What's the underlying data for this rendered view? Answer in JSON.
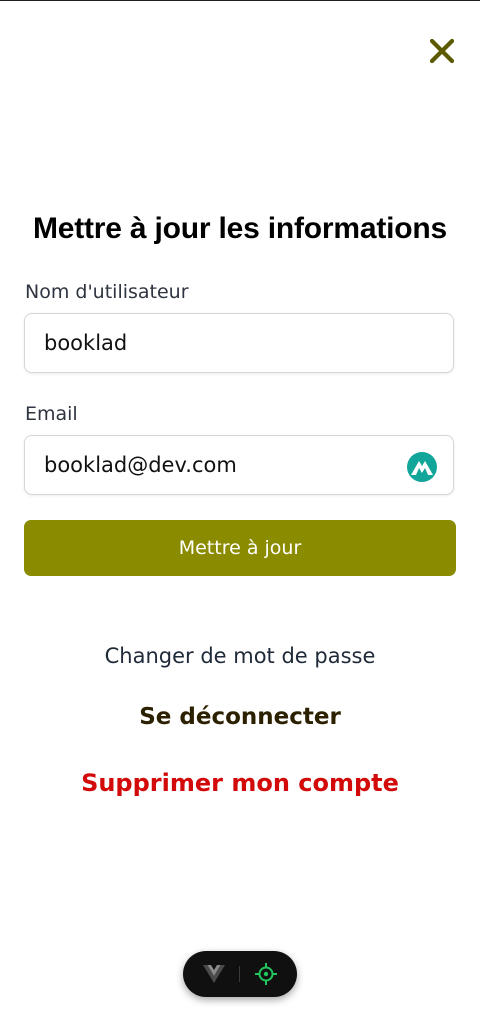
{
  "header": {
    "close_icon": "close-x-icon",
    "accent_color": "#5c5a00"
  },
  "form": {
    "title": "Mettre à jour les informations",
    "username_label": "Nom d'utilisateur",
    "username_value": "booklad",
    "email_label": "Email",
    "email_value": "booklad@dev.com",
    "email_extension_icon": "password-manager-mountain-icon",
    "submit_label": "Mettre à jour",
    "submit_color": "#8b8b00"
  },
  "actions": {
    "change_password": "Changer de mot de passe",
    "logout": "Se déconnecter",
    "delete_account": "Supprimer mon compte",
    "delete_color": "#d20a0a"
  },
  "devtools": {
    "vue_icon": "vue-logo-icon",
    "inspect_icon": "crosshair-target-icon"
  }
}
